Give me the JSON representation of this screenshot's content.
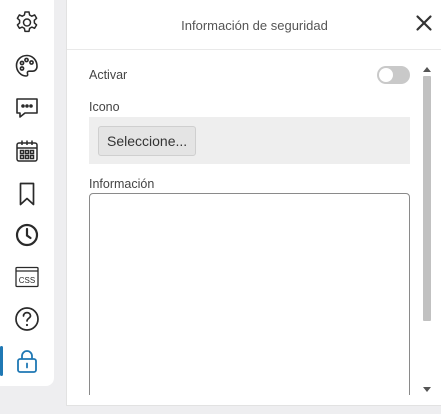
{
  "sidebar": {
    "items": [
      {
        "name": "settings",
        "icon": "gear-icon"
      },
      {
        "name": "theme",
        "icon": "palette-icon"
      },
      {
        "name": "chat",
        "icon": "chat-bubble-icon"
      },
      {
        "name": "calendar",
        "icon": "calendar-icon"
      },
      {
        "name": "bookmark",
        "icon": "bookmark-icon"
      },
      {
        "name": "history",
        "icon": "clock-icon"
      },
      {
        "name": "css",
        "icon": "css-icon",
        "text": "CSS"
      },
      {
        "name": "help",
        "icon": "question-icon"
      },
      {
        "name": "security",
        "icon": "lock-icon",
        "active": true
      }
    ],
    "icon_color": "#2a2a2a",
    "active_color": "#1f78b4"
  },
  "panel": {
    "title": "Información de seguridad",
    "activate_label": "Activar",
    "activate_on": false,
    "icon_label": "Icono",
    "select_button": "Seleccione...",
    "info_label": "Información",
    "info_value": ""
  }
}
